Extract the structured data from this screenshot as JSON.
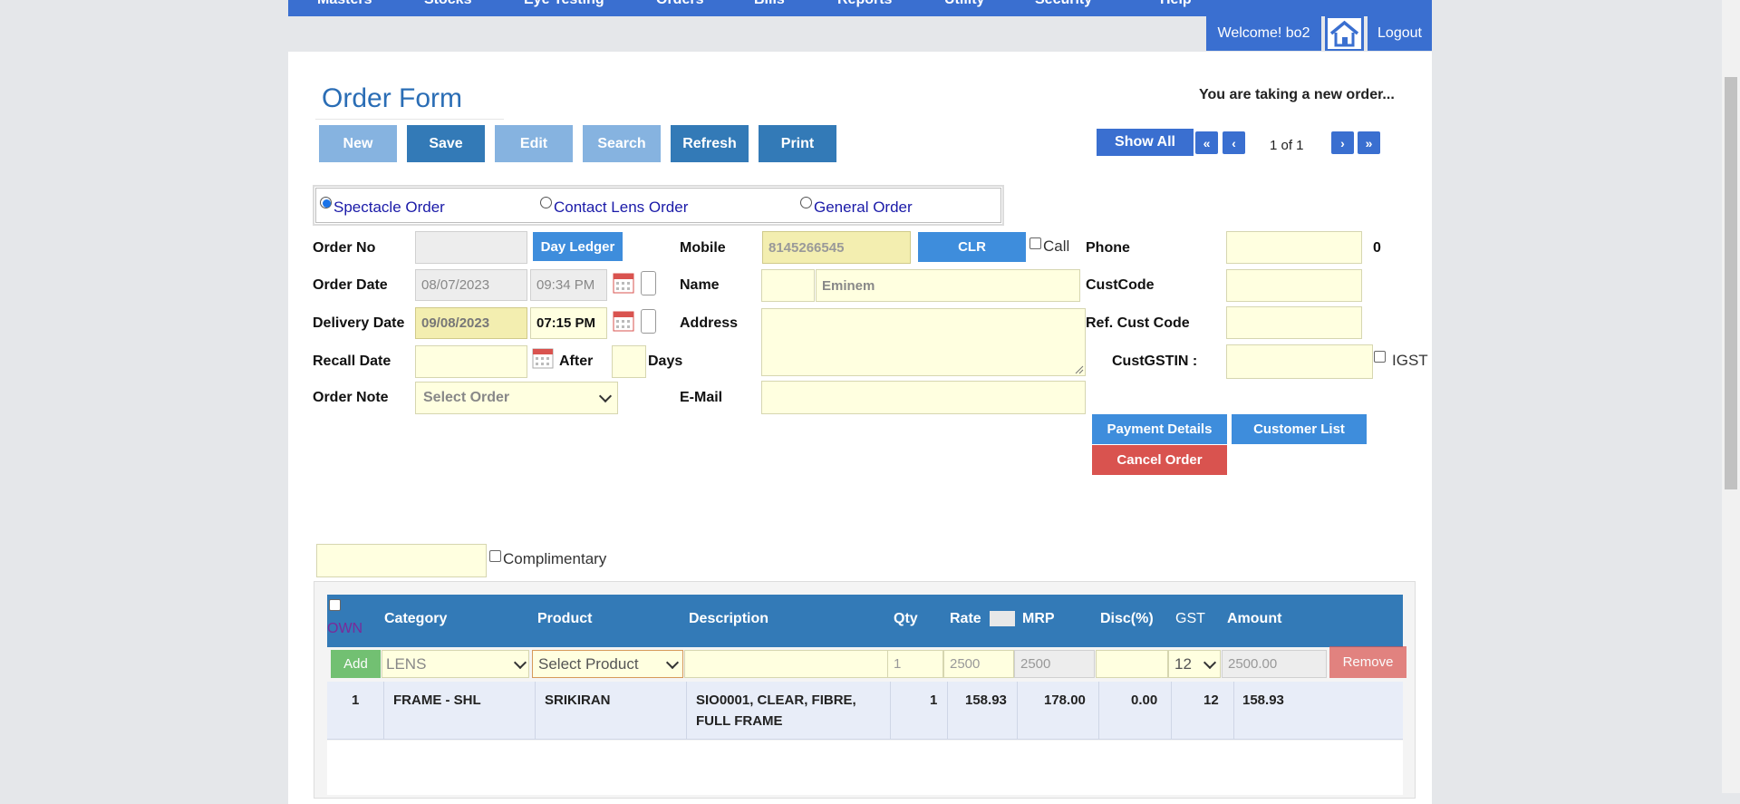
{
  "nav": {
    "items": [
      "Masters",
      "Stocks",
      "Eye Testing",
      "Orders",
      "Bills",
      "Reports",
      "Utility",
      "Security",
      "Help"
    ]
  },
  "userbar": {
    "welcome": "Welcome! bo2",
    "logout": "Logout"
  },
  "form": {
    "title": "Order Form",
    "status": "You are taking a new order...",
    "toolbar": {
      "new": "New",
      "save": "Save",
      "edit": "Edit",
      "search": "Search",
      "refresh": "Refresh",
      "print": "Print"
    },
    "pager": {
      "show_all": "Show All",
      "first": "«",
      "prev": "‹",
      "info": "1 of 1",
      "next": "›",
      "last": "»"
    },
    "order_types": {
      "spectacle": "Spectacle Order",
      "contact": "Contact Lens Order",
      "general": "General Order",
      "selected": "spectacle"
    },
    "fields": {
      "order_no_label": "Order No",
      "day_ledger": "Day Ledger",
      "order_date_label": "Order Date",
      "order_date": "08/07/2023",
      "order_time": "09:34 PM",
      "delivery_date_label": "Delivery Date",
      "delivery_date": "09/08/2023",
      "delivery_time": "07:15 PM",
      "recall_date_label": "Recall Date",
      "after_label": "After",
      "days_label": "Days",
      "order_note_label": "Order Note",
      "order_note_value": "Select Order",
      "mobile_label": "Mobile",
      "mobile_value": "8145266545",
      "clr": "CLR",
      "call_label": "Call",
      "name_label": "Name",
      "name_value": "Eminem",
      "address_label": "Address",
      "email_label": "E-Mail",
      "phone_label": "Phone",
      "phone_count": "0",
      "custcode_label": "CustCode",
      "refcust_label": "Ref. Cust Code",
      "custgstin_label": "CustGSTIN :",
      "igst_label": "IGST"
    },
    "actions": {
      "payment_details": "Payment Details",
      "customer_list": "Customer List",
      "cancel_order": "Cancel Order"
    },
    "complimentary_label": "Complimentary"
  },
  "grid": {
    "headers": {
      "own": "OWN",
      "category": "Category",
      "product": "Product",
      "description": "Description",
      "qty": "Qty",
      "rate": "Rate",
      "mrp": "MRP",
      "disc": "Disc(%)",
      "gst": "GST",
      "amount": "Amount"
    },
    "entry": {
      "add": "Add",
      "category": "LENS",
      "product": "Select Product",
      "qty": "1",
      "rate": "2500",
      "mrp": "2500",
      "gst": "12",
      "amount": "2500.00",
      "remove": "Remove"
    },
    "rows": [
      {
        "sno": "1",
        "category": "FRAME - SHL",
        "product": "SRIKIRAN",
        "desc1": "SIO0001, CLEAR, FIBRE,",
        "desc2": "FULL FRAME",
        "qty": "1",
        "rate": "158.93",
        "mrp": "178.00",
        "disc": "0.00",
        "gst": "12",
        "amount": "158.93"
      }
    ]
  },
  "colors": {
    "nav": "#3a6fd0",
    "primary": "#337ab7",
    "danger": "#d9534f",
    "field": "#ffffe0",
    "title": "#2a6db5"
  }
}
